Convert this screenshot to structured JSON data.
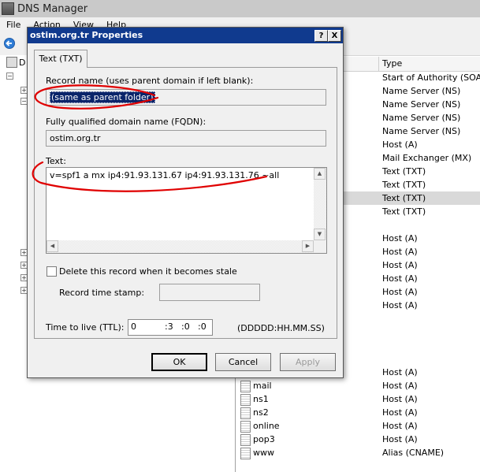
{
  "app": {
    "title": "DNS Manager"
  },
  "menu": {
    "file": "File",
    "action": "Action",
    "view": "View",
    "help": "Help"
  },
  "tree": {
    "partial_label": "D"
  },
  "list": {
    "type_header": "Type",
    "types_top": [
      "Start of Authority (SOA)",
      "Name Server (NS)",
      "Name Server (NS)",
      "Name Server (NS)",
      "Name Server (NS)",
      "Host (A)",
      "Mail Exchanger (MX)",
      "Text (TXT)",
      "Text (TXT)",
      "Text (TXT)",
      "Text (TXT)"
    ],
    "types_mid": [
      "Host (A)",
      "Host (A)",
      "Host (A)",
      "Host (A)",
      "Host (A)",
      "Host (A)"
    ],
    "type_row_bottom": "Host (A)",
    "records": [
      {
        "name": "mail",
        "type": "Host (A)"
      },
      {
        "name": "ns1",
        "type": "Host (A)"
      },
      {
        "name": "ns2",
        "type": "Host (A)"
      },
      {
        "name": "online",
        "type": "Host (A)"
      },
      {
        "name": "pop3",
        "type": "Host (A)"
      },
      {
        "name": "www",
        "type": "Alias (CNAME)"
      }
    ]
  },
  "dialog": {
    "title": "ostim.org.tr Properties",
    "help_btn": "?",
    "close_btn": "X",
    "tab": "Text (TXT)",
    "record_name_label": "Record name (uses parent domain if left blank):",
    "record_name_value": "(same as parent folder)",
    "fqdn_label": "Fully qualified domain name (FQDN):",
    "fqdn_value": "ostim.org.tr",
    "text_label": "Text:",
    "text_value": "v=spf1 a mx  ip4:91.93.131.67 ip4:91.93.131.76  ~all",
    "stale_label": "Delete this record when it becomes stale",
    "stale_checked": false,
    "timestamp_label": "Record time stamp:",
    "timestamp_value": "",
    "ttl_label": "Time to live (TTL):",
    "ttl_days": "0",
    "ttl_hours": ":3",
    "ttl_minutes": ":0",
    "ttl_seconds": ":0",
    "ttl_format": "(DDDDD:HH.MM.SS)",
    "ok": "OK",
    "cancel": "Cancel",
    "apply": "Apply"
  },
  "colors": {
    "annotation": "#e00000",
    "title_bar": "#103a8e",
    "selection": "#0a246a"
  }
}
